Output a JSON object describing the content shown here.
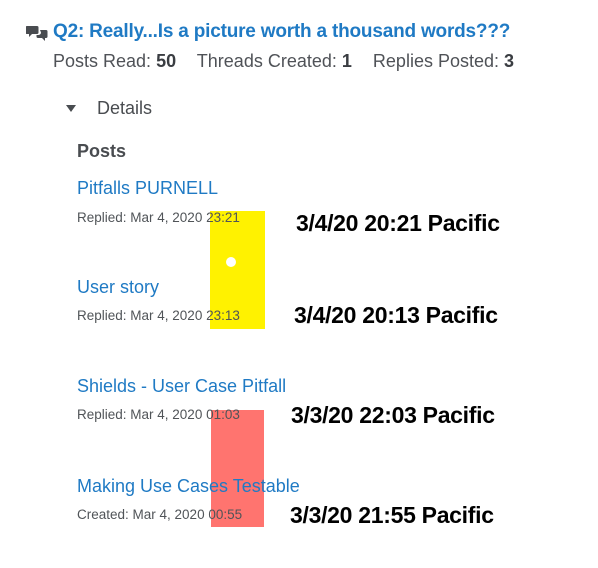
{
  "topic": {
    "title": "Q2: Really...Is a picture worth a thousand words???",
    "icon": "discussion-bubbles-icon",
    "accent_color": "#1f7ac4"
  },
  "stats": [
    {
      "label": "Posts Read:",
      "value": "50"
    },
    {
      "label": "Threads Created:",
      "value": "1"
    },
    {
      "label": "Replies Posted:",
      "value": "3"
    }
  ],
  "details": {
    "label": "Details",
    "expanded": true
  },
  "posts_heading": "Posts",
  "posts": [
    {
      "title": "Pitfalls PURNELL",
      "prefix": "Replied: Mar 4, 2020",
      "time": "23:21"
    },
    {
      "title": "User story",
      "prefix": "Replied: Mar 4, 2020",
      "time": "23:13"
    },
    {
      "title": "Shields - User Case Pitfall",
      "prefix": "Replied: Mar 4, 2020",
      "time": "01:03"
    },
    {
      "title": "Making Use Cases Testable",
      "prefix": "Created: Mar 4, 2020",
      "time": "00:55"
    }
  ],
  "annotations": [
    "3/4/20 20:21 Pacific",
    "3/4/20 20:13 Pacific",
    "3/3/20 22:03 Pacific",
    "3/3/20 21:55 Pacific"
  ],
  "highlight_colors": {
    "yellow": "#fff200",
    "red": "#ff6d67"
  }
}
